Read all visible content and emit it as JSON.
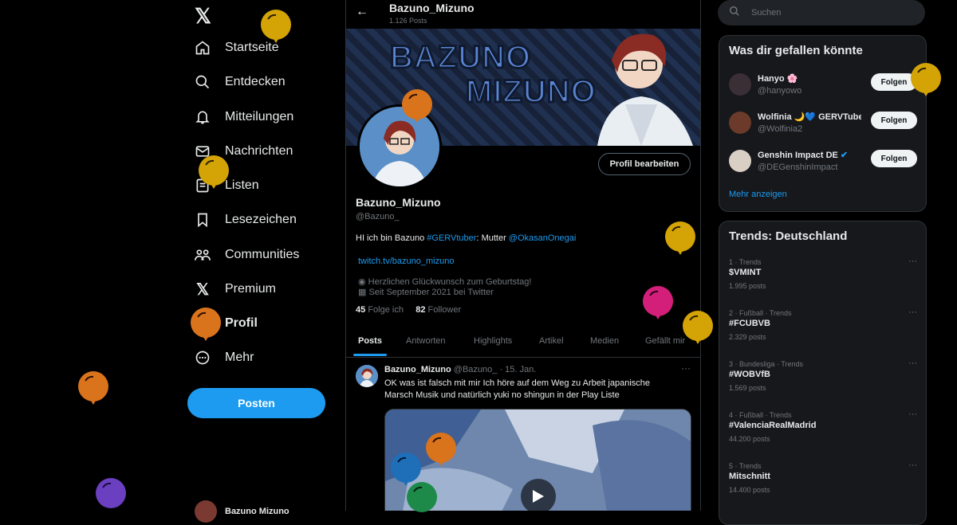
{
  "nav": {
    "items": [
      {
        "label": "Startseite",
        "icon": "home-icon"
      },
      {
        "label": "Entdecken",
        "icon": "search-icon"
      },
      {
        "label": "Mitteilungen",
        "icon": "bell-icon"
      },
      {
        "label": "Nachrichten",
        "icon": "mail-icon"
      },
      {
        "label": "Listen",
        "icon": "list-icon"
      },
      {
        "label": "Lesezeichen",
        "icon": "bookmark-icon"
      },
      {
        "label": "Communities",
        "icon": "communities-icon"
      },
      {
        "label": "Premium",
        "icon": "x-logo-icon"
      },
      {
        "label": "Profil",
        "icon": "user-icon"
      },
      {
        "label": "Mehr",
        "icon": "more-circle-icon"
      }
    ],
    "post_button": "Posten",
    "account_name": "Bazuno Mizuno"
  },
  "profile": {
    "title": "Bazuno_Mizuno",
    "post_count": "1.126 Posts",
    "banner_line1": "BAZUNO",
    "banner_line2": "MIZUNO",
    "edit_button": "Profil bearbeiten",
    "name": "Bazuno_Mizuno",
    "handle": "@Bazuno_",
    "bio_prefix": "HI ich bin Bazuno ",
    "bio_tag": "#GERVtuber",
    "bio_mid": ": Mutter ",
    "bio_mention": "@OkasanOnegai",
    "link": "twitch.tv/bazuno_mizuno",
    "birthday": "Herzlichen Glückwunsch zum Geburtstag!",
    "joined": "Seit September 2021 bei Twitter",
    "following_count": "45",
    "following_label": "Folge ich",
    "followers_count": "82",
    "followers_label": "Follower"
  },
  "tabs": [
    "Posts",
    "Antworten",
    "Highlights",
    "Artikel",
    "Medien",
    "Gefällt mir"
  ],
  "tweet": {
    "name": "Bazuno_Mizuno",
    "handle": "@Bazuno_",
    "date": "· 15. Jan.",
    "text": "OK was ist falsch mit mir Ich höre auf dem Weg zu Arbeit japanische Marsch Musik und natürlich yuki no shingun in der Play Liste"
  },
  "search": {
    "placeholder": "Suchen"
  },
  "suggestions": {
    "title": "Was dir gefallen könnte",
    "items": [
      {
        "name": "Hanyo 🌸",
        "handle": "@hanyowo",
        "button": "Folgen"
      },
      {
        "name": "Wolfinia 🌙💙 GERVTuber",
        "handle": "@Wolfinia2",
        "button": "Folgen"
      },
      {
        "name": "Genshin Impact DE",
        "handle": "@DEGenshinImpact",
        "button": "Folgen"
      }
    ],
    "more": "Mehr anzeigen"
  },
  "trends": {
    "title": "Trends: Deutschland",
    "items": [
      {
        "context": "1 · Trends",
        "name": "$VMINT",
        "count": "1.995 posts"
      },
      {
        "context": "2 · Fußball · Trends",
        "name": "#FCUBVB",
        "count": "2.329 posts"
      },
      {
        "context": "3 · Bundesliga · Trends",
        "name": "#WOBVfB",
        "count": "1.569 posts"
      },
      {
        "context": "4 · Fußball · Trends",
        "name": "#ValenciaRealMadrid",
        "count": "44.200 posts"
      },
      {
        "context": "5 · Trends",
        "name": "Mitschnitt",
        "count": "14.400 posts"
      }
    ]
  },
  "colors": {
    "accent": "#1d9bf0",
    "background": "#000000",
    "card": "#16181c"
  }
}
